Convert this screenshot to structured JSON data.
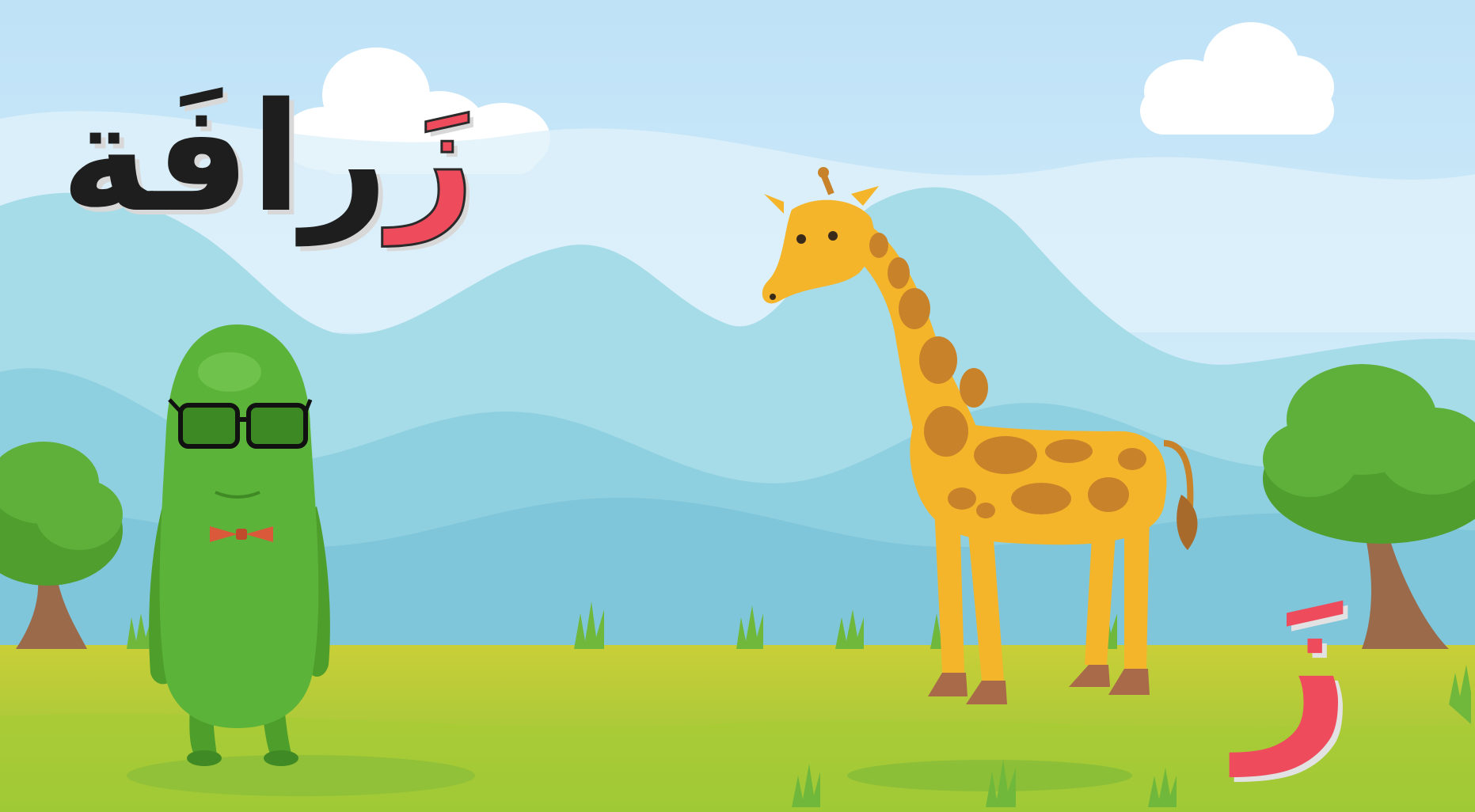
{
  "title_word": {
    "first_letter": "زَ",
    "rest": "رافَة"
  },
  "featured_letter": "زَ",
  "characters": [
    "giraffe",
    "green-bean-character"
  ],
  "colors": {
    "sky": "#cfe9f8",
    "mountains": "#8fd0e0",
    "ground": "#a8cc33",
    "letter_highlight": "#ee4b5c",
    "giraffe_body": "#f4b52a",
    "giraffe_spots": "#c8832a",
    "character_green": "#5cb33a"
  }
}
